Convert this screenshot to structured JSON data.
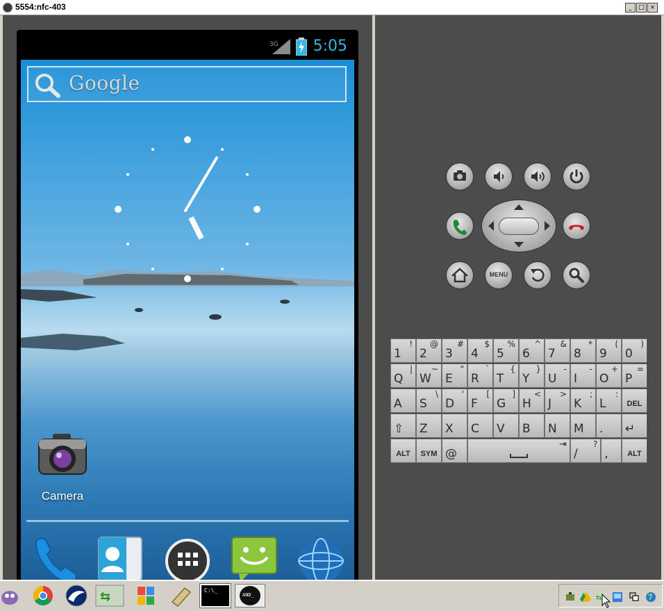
{
  "window": {
    "title": "5554:nfc-403",
    "controls": {
      "minimize": "_",
      "maximize": "□",
      "close": "×"
    }
  },
  "status_bar": {
    "time": "5:05",
    "network": "3G",
    "icons": [
      "signal-3g-icon",
      "battery-charging-icon"
    ]
  },
  "home_screen": {
    "search_label": "Google",
    "apps": [
      {
        "label": "Camera",
        "icon": "camera-icon"
      }
    ],
    "dock": [
      "phone-icon",
      "contacts-icon",
      "all-apps-icon",
      "messaging-icon",
      "browser-icon"
    ]
  },
  "hardware_buttons": {
    "row1": [
      "camera-icon",
      "volume-down-icon",
      "volume-up-icon",
      "power-icon"
    ],
    "row2": [
      "call-icon",
      "dpad",
      "end-call-icon"
    ],
    "row3": [
      "home-icon",
      "menu",
      "back-icon",
      "search-icon"
    ],
    "menu_label": "MENU"
  },
  "keyboard": {
    "rows": [
      [
        [
          "1",
          "!"
        ],
        [
          "2",
          "@"
        ],
        [
          "3",
          "#"
        ],
        [
          "4",
          "$"
        ],
        [
          "5",
          "%"
        ],
        [
          "6",
          "^"
        ],
        [
          "7",
          "&"
        ],
        [
          "8",
          "*"
        ],
        [
          "9",
          "("
        ],
        [
          "0",
          ")"
        ]
      ],
      [
        [
          "Q",
          "|"
        ],
        [
          "W",
          "~"
        ],
        [
          "E",
          "\""
        ],
        [
          "R",
          "`"
        ],
        [
          "T",
          "{"
        ],
        [
          "Y",
          "}"
        ],
        [
          "U",
          "-"
        ],
        [
          "I",
          "-"
        ],
        [
          "O",
          "+"
        ],
        [
          "P",
          "="
        ]
      ],
      [
        [
          "A",
          ""
        ],
        [
          "S",
          "\\"
        ],
        [
          "D",
          "'"
        ],
        [
          "F",
          "["
        ],
        [
          "G",
          "]"
        ],
        [
          "H",
          "<"
        ],
        [
          "J",
          ">"
        ],
        [
          "K",
          ";"
        ],
        [
          "L",
          ":"
        ],
        [
          "DEL",
          ""
        ]
      ],
      [
        [
          "⇧",
          ""
        ],
        [
          "Z",
          ""
        ],
        [
          "X",
          ""
        ],
        [
          "C",
          ""
        ],
        [
          "V",
          ""
        ],
        [
          "B",
          ""
        ],
        [
          "N",
          ""
        ],
        [
          "M",
          ""
        ],
        [
          ".",
          ""
        ],
        [
          "↵",
          ""
        ]
      ],
      [
        [
          "ALT",
          ""
        ],
        [
          "SYM",
          ""
        ],
        [
          "@",
          ""
        ],
        [
          "",
          ""
        ],
        [
          "/",
          "?"
        ],
        [
          ",",
          ""
        ],
        [
          "ALT",
          ""
        ]
      ]
    ]
  },
  "taskbar": {
    "apps": [
      "pidgin-icon",
      "chrome-icon",
      "pixel-icon",
      "arrows-icon",
      "office-icon",
      "scroll-icon",
      "cmd-icon",
      "android-icon"
    ],
    "cmd_label": "C:\\_",
    "android_label": "AND_",
    "tray": [
      "network-icon",
      "drive-icon",
      "sync-icon",
      "display-icon",
      "windows-icon",
      "globe-icon"
    ]
  }
}
